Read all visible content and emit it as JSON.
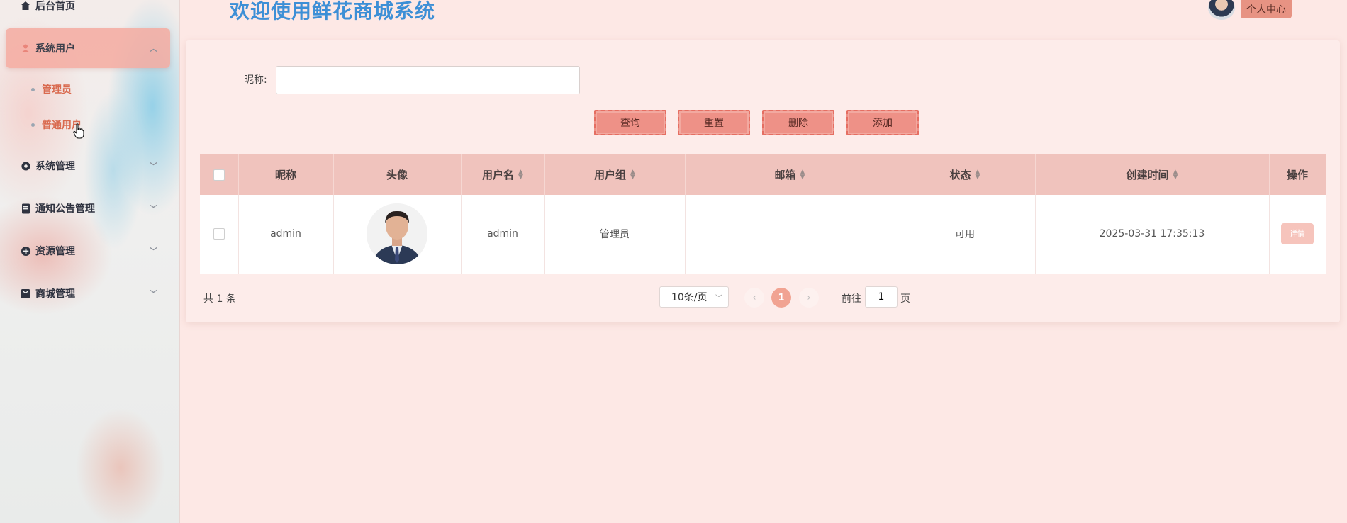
{
  "header": {
    "title": "欢迎使用鲜花商城系统",
    "user_center": "个人中心"
  },
  "sidebar": {
    "items": [
      {
        "label": "后台首页",
        "icon": "home-icon"
      },
      {
        "label": "系统用户",
        "icon": "user-icon",
        "active": true,
        "sub": [
          {
            "label": "管理员"
          },
          {
            "label": "普通用户"
          }
        ]
      },
      {
        "label": "系统管理",
        "icon": "gear-icon"
      },
      {
        "label": "通知公告管理",
        "icon": "document-icon"
      },
      {
        "label": "资源管理",
        "icon": "plus-circle-icon"
      },
      {
        "label": "商城管理",
        "icon": "bag-icon"
      }
    ]
  },
  "search": {
    "label": "昵称:",
    "value": "",
    "placeholder": ""
  },
  "toolbar": {
    "query": "查询",
    "reset": "重置",
    "delete": "删除",
    "add": "添加"
  },
  "table": {
    "columns": [
      "昵称",
      "头像",
      "用户名",
      "用户组",
      "邮箱",
      "状态",
      "创建时间",
      "操作"
    ],
    "rows": [
      {
        "nickname": "admin",
        "username": "admin",
        "group": "管理员",
        "email": "",
        "status": "可用",
        "created": "2025-03-31 17:35:13",
        "action": "详情"
      }
    ]
  },
  "pagination": {
    "total": "共 1 条",
    "page_size": "10条/页",
    "current_page": "1",
    "goto_prefix": "前往",
    "goto_value": "1",
    "goto_suffix": "页"
  },
  "colors": {
    "accent": "#ee9187",
    "header_row": "#f0c3bd",
    "title": "#3d8fd6",
    "background": "#fde8e5"
  }
}
